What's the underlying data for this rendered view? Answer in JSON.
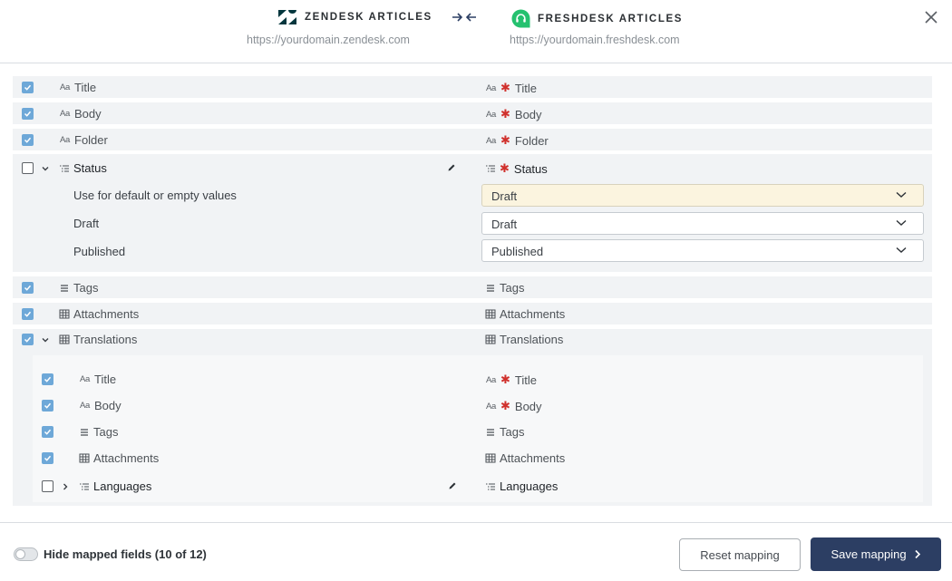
{
  "header": {
    "source_name": "ZENDESK ARTICLES",
    "source_url": "https://yourdomain.zendesk.com",
    "target_name": "FRESHDESK ARTICLES",
    "target_url": "https://yourdomain.freshdesk.com"
  },
  "icons": {
    "text_type": "Aa",
    "required_mark": "✱"
  },
  "rows": {
    "title": {
      "source": "Title",
      "target": "Title",
      "checked": true
    },
    "body": {
      "source": "Body",
      "target": "Body",
      "checked": true
    },
    "folder": {
      "source": "Folder",
      "target": "Folder",
      "checked": true
    },
    "status": {
      "source": "Status",
      "target": "Status",
      "checked": false,
      "expanded": true,
      "values": [
        {
          "label": "Use for default or empty values",
          "selected": "Draft"
        },
        {
          "label": "Draft",
          "selected": "Draft"
        },
        {
          "label": "Published",
          "selected": "Published"
        }
      ]
    },
    "tags": {
      "source": "Tags",
      "target": "Tags",
      "checked": true
    },
    "attachments": {
      "source": "Attachments",
      "target": "Attachments",
      "checked": true
    },
    "translations": {
      "source": "Translations",
      "target": "Translations",
      "checked": true,
      "expanded": true,
      "children": {
        "title": {
          "source": "Title",
          "target": "Title",
          "checked": true
        },
        "body": {
          "source": "Body",
          "target": "Body",
          "checked": true
        },
        "tags": {
          "source": "Tags",
          "target": "Tags",
          "checked": true
        },
        "attachments": {
          "source": "Attachments",
          "target": "Attachments",
          "checked": true
        },
        "languages": {
          "source": "Languages",
          "target": "Languages",
          "checked": false,
          "expanded": false
        }
      }
    }
  },
  "footer": {
    "toggle_label": "Hide mapped fields (10 of 12)",
    "toggle_on": false,
    "reset_label": "Reset mapping",
    "save_label": "Save mapping"
  },
  "colors": {
    "primary": "#2c3e63",
    "checkbox": "#6ea8d8",
    "required": "#d0312d",
    "zendesk": "#03363d",
    "freshdesk": "#25c16f",
    "highlight": "#fbf4df"
  }
}
